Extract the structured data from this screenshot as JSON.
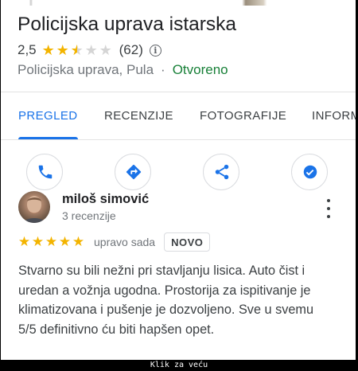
{
  "place": {
    "title": "Policijska uprava istarska",
    "rating": "2,5",
    "rating_value": 2.5,
    "rating_max": 5,
    "review_count": "(62)",
    "category": "Policijska uprava, Pula",
    "separator": "·",
    "status": "Otvoreno"
  },
  "tabs": [
    {
      "label": "PREGLED",
      "active": true
    },
    {
      "label": "RECENZIJE",
      "active": false
    },
    {
      "label": "FOTOGRAFIJE",
      "active": false
    },
    {
      "label": "INFORM",
      "active": false
    }
  ],
  "actions": [
    {
      "icon": "phone-icon"
    },
    {
      "icon": "directions-icon"
    },
    {
      "icon": "share-icon"
    },
    {
      "icon": "save-icon"
    }
  ],
  "review": {
    "author": "miloš simović",
    "author_meta": "3 recenzije",
    "stars": 5,
    "time": "upravo sada",
    "badge": "NOVO",
    "text_lines": [
      "Stvarno su bili nežni pri stavljanju lisica. Auto čist i",
      "uredan a vožnja ugodna. Prostorija za ispitivanje je",
      "klimatizovana i pušenje je dozvoljeno. Sve u svemu",
      "5/5 definitivno ću biti hapšen opet."
    ]
  },
  "caption": "Klik za veću",
  "colors": {
    "accent": "#1a73e8",
    "star": "#f3b400",
    "open_status": "#188038"
  }
}
